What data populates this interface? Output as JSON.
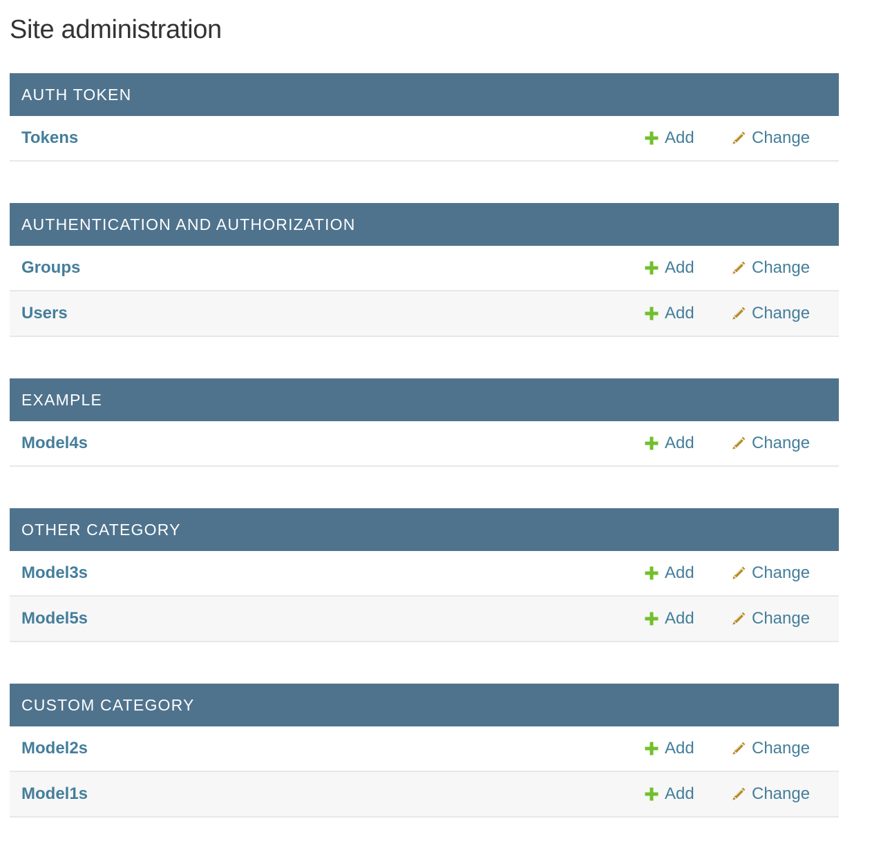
{
  "page_title": "Site administration",
  "colors": {
    "caption_bg": "#4f738d",
    "caption_text": "#ffffff",
    "link": "#447e9b",
    "add_icon": "#70bf2b",
    "change_icon": "#b88a2a",
    "row_alt": "#f7f7f7",
    "row_border": "#e7e7e7"
  },
  "icons": {
    "add": "plus-icon",
    "change": "pencil-icon"
  },
  "modules": [
    {
      "caption": "AUTH TOKEN",
      "models": [
        {
          "name": "Tokens",
          "add_label": "Add",
          "change_label": "Change"
        }
      ]
    },
    {
      "caption": "AUTHENTICATION AND AUTHORIZATION",
      "models": [
        {
          "name": "Groups",
          "add_label": "Add",
          "change_label": "Change"
        },
        {
          "name": "Users",
          "add_label": "Add",
          "change_label": "Change"
        }
      ]
    },
    {
      "caption": "EXAMPLE",
      "models": [
        {
          "name": "Model4s",
          "add_label": "Add",
          "change_label": "Change"
        }
      ]
    },
    {
      "caption": "OTHER CATEGORY",
      "models": [
        {
          "name": "Model3s",
          "add_label": "Add",
          "change_label": "Change"
        },
        {
          "name": "Model5s",
          "add_label": "Add",
          "change_label": "Change"
        }
      ]
    },
    {
      "caption": "CUSTOM CATEGORY",
      "models": [
        {
          "name": "Model2s",
          "add_label": "Add",
          "change_label": "Change"
        },
        {
          "name": "Model1s",
          "add_label": "Add",
          "change_label": "Change"
        }
      ]
    }
  ]
}
